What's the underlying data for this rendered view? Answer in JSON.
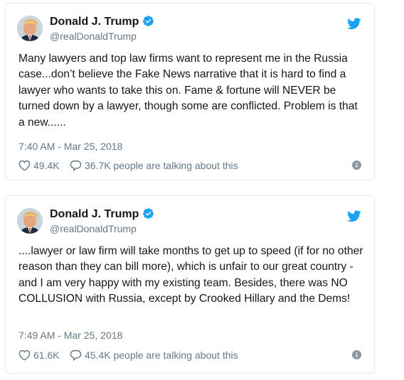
{
  "colors": {
    "verified_blue": "#1da1f2",
    "twitter_blue": "#1da1f2",
    "secondary_text": "#657786",
    "primary_text": "#14171a",
    "border": "#e1e8ed"
  },
  "tweets": [
    {
      "author_name": "Donald J. Trump",
      "handle": "@realDonaldTrump",
      "text": "Many lawyers and top law firms want to represent me in the Russia case...don’t believe the Fake News narrative that it is hard to find a lawyer who wants to take this on. Fame & fortune will NEVER be turned down by a lawyer, though some are conflicted. Problem is that a new......",
      "timestamp": "7:40 AM - Mar 25, 2018",
      "likes": "49.4K",
      "talking": "36.7K people are talking about this",
      "icons": [
        "avatar",
        "verified-badge-icon",
        "twitter-bird-icon",
        "heart-icon",
        "speech-bubble-icon",
        "info-icon"
      ]
    },
    {
      "author_name": "Donald J. Trump",
      "handle": "@realDonaldTrump",
      "text": "....lawyer or law firm will take months to get up to speed (if for no other reason than they can bill more), which is unfair to our great country - and I am very happy with my existing team. Besides, there was NO COLLUSION with Russia, except by Crooked Hillary and the Dems!",
      "timestamp": "7:49 AM - Mar 25, 2018",
      "likes": "61.6K",
      "talking": "45.4K people are talking about this",
      "icons": [
        "avatar",
        "verified-badge-icon",
        "twitter-bird-icon",
        "heart-icon",
        "speech-bubble-icon",
        "info-icon"
      ]
    }
  ]
}
